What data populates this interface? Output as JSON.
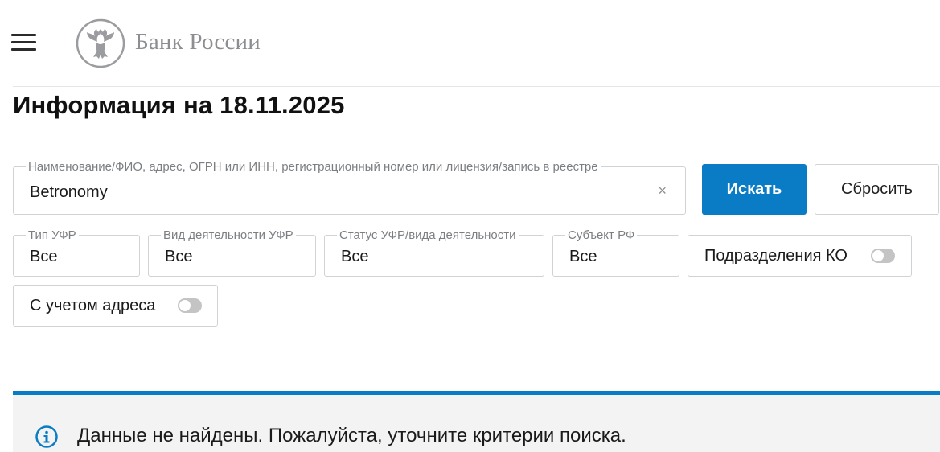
{
  "header": {
    "brand_name": "Банк России"
  },
  "page_title": "Информация на 18.11.2025",
  "search": {
    "label": "Наименование/ФИО, адрес, ОГРН или ИНН, регистрационный номер или лицензия/запись в реестре",
    "value": "Betronomy",
    "clear_icon": "×",
    "search_button": "Искать",
    "reset_button": "Сбросить"
  },
  "filters": {
    "type": {
      "label": "Тип УФР",
      "value": "Все"
    },
    "activity": {
      "label": "Вид деятельности УФР",
      "value": "Все"
    },
    "status": {
      "label": "Статус УФР/вида деятельности",
      "value": "Все"
    },
    "subject": {
      "label": "Субъект РФ",
      "value": "Все"
    }
  },
  "toggles": {
    "ko_divisions": {
      "label": "Подразделения КО",
      "on": false
    },
    "with_address": {
      "label": "С учетом адреса",
      "on": false
    }
  },
  "notice": {
    "message": "Данные не найдены. Пожалуйста, уточните критерии поиска.",
    "icon": "info-icon"
  },
  "colors": {
    "accent": "#0a7cc5",
    "brand_gray": "#8c8e91",
    "notice_bg": "#f3f3f3"
  }
}
